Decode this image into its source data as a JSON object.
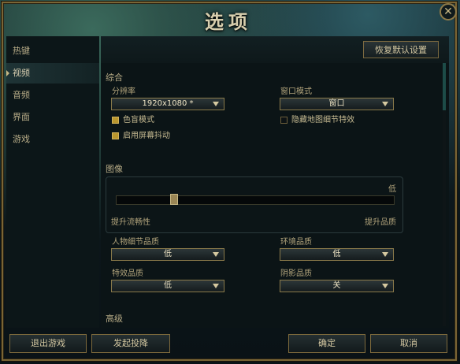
{
  "window": {
    "title": "选项",
    "close_glyph": "✕"
  },
  "sidebar": {
    "items": [
      {
        "label": "热键"
      },
      {
        "label": "视频"
      },
      {
        "label": "音频"
      },
      {
        "label": "界面"
      },
      {
        "label": "游戏"
      }
    ]
  },
  "toolbar": {
    "reset_label": "恢复默认设置"
  },
  "general": {
    "section": "综合",
    "resolution_label": "分辨率",
    "resolution_value": "1920x1080 *",
    "window_mode_label": "窗口模式",
    "window_mode_value": "窗口",
    "colorblind_label": "色盲模式",
    "colorblind_checked": true,
    "screenshake_label": "启用屏幕抖动",
    "screenshake_checked": true,
    "hide_eyecandy_label": "隐藏地图细节特效",
    "hide_eyecandy_checked": false
  },
  "graphics": {
    "section": "图像",
    "preset_value": "低",
    "slider_level": 0.2,
    "left_label": "提升流畅性",
    "right_label": "提升品质"
  },
  "quality": {
    "character_label": "人物细节品质",
    "character_value": "低",
    "environment_label": "环境品质",
    "environment_value": "低",
    "effects_label": "特效品质",
    "effects_value": "低",
    "shadow_label": "阴影品质",
    "shadow_value": "关"
  },
  "advanced": {
    "section": "高级"
  },
  "buttons": {
    "exit_game": "退出游戏",
    "surrender": "发起投降",
    "ok": "确定",
    "cancel": "取消"
  },
  "colors": {
    "gold_border": "#7a6535",
    "checkbox_on": "#b9962e",
    "accent_teal": "#1d4c48"
  }
}
